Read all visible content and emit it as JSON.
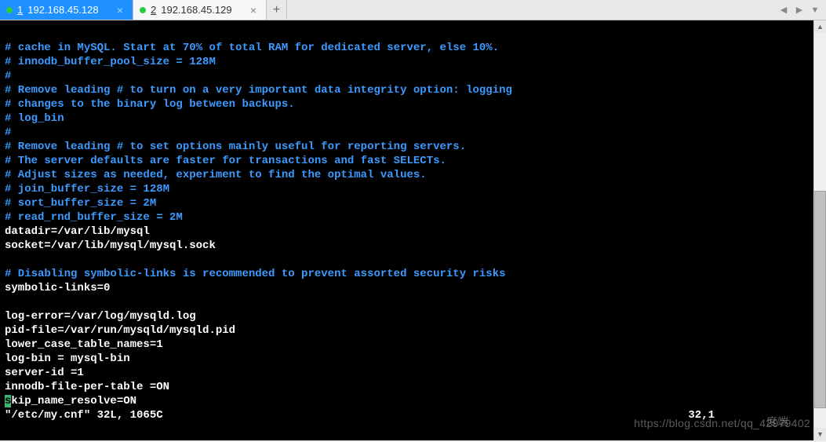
{
  "tabs": [
    {
      "num": "1",
      "label": "192.168.45.128",
      "active": true
    },
    {
      "num": "2",
      "label": "192.168.45.129",
      "active": false
    }
  ],
  "add_label": "+",
  "close_label": "×",
  "lines": [
    {
      "cls": "comment",
      "text": "# cache in MySQL. Start at 70% of total RAM for dedicated server, else 10%."
    },
    {
      "cls": "comment",
      "text": "# innodb_buffer_pool_size = 128M"
    },
    {
      "cls": "comment",
      "text": "#"
    },
    {
      "cls": "comment",
      "text": "# Remove leading # to turn on a very important data integrity option: logging"
    },
    {
      "cls": "comment",
      "text": "# changes to the binary log between backups."
    },
    {
      "cls": "comment",
      "text": "# log_bin"
    },
    {
      "cls": "comment",
      "text": "#"
    },
    {
      "cls": "comment",
      "text": "# Remove leading # to set options mainly useful for reporting servers."
    },
    {
      "cls": "comment",
      "text": "# The server defaults are faster for transactions and fast SELECTs."
    },
    {
      "cls": "comment",
      "text": "# Adjust sizes as needed, experiment to find the optimal values."
    },
    {
      "cls": "comment",
      "text": "# join_buffer_size = 128M"
    },
    {
      "cls": "comment",
      "text": "# sort_buffer_size = 2M"
    },
    {
      "cls": "comment",
      "text": "# read_rnd_buffer_size = 2M"
    },
    {
      "cls": "normal",
      "text": "datadir=/var/lib/mysql"
    },
    {
      "cls": "normal",
      "text": "socket=/var/lib/mysql/mysql.sock"
    },
    {
      "cls": "normal",
      "text": ""
    },
    {
      "cls": "comment",
      "text": "# Disabling symbolic-links is recommended to prevent assorted security risks"
    },
    {
      "cls": "normal",
      "text": "symbolic-links=0"
    },
    {
      "cls": "normal",
      "text": ""
    },
    {
      "cls": "normal",
      "text": "log-error=/var/log/mysqld.log"
    },
    {
      "cls": "normal",
      "text": "pid-file=/var/run/mysqld/mysqld.pid"
    },
    {
      "cls": "normal",
      "text": "lower_case_table_names=1"
    },
    {
      "cls": "normal",
      "text": "log-bin = mysql-bin"
    },
    {
      "cls": "normal",
      "text": "server-id =1"
    },
    {
      "cls": "normal",
      "text": "innodb-file-per-table =ON"
    }
  ],
  "cursor_line": {
    "first": "s",
    "rest": "kip_name_resolve=ON"
  },
  "status": {
    "file": "\"/etc/my.cnf\" 32L, 1065C",
    "pos": "32,1"
  },
  "watermark": "https://blog.csdn.net/qq_42979402",
  "watermark2": "度端"
}
